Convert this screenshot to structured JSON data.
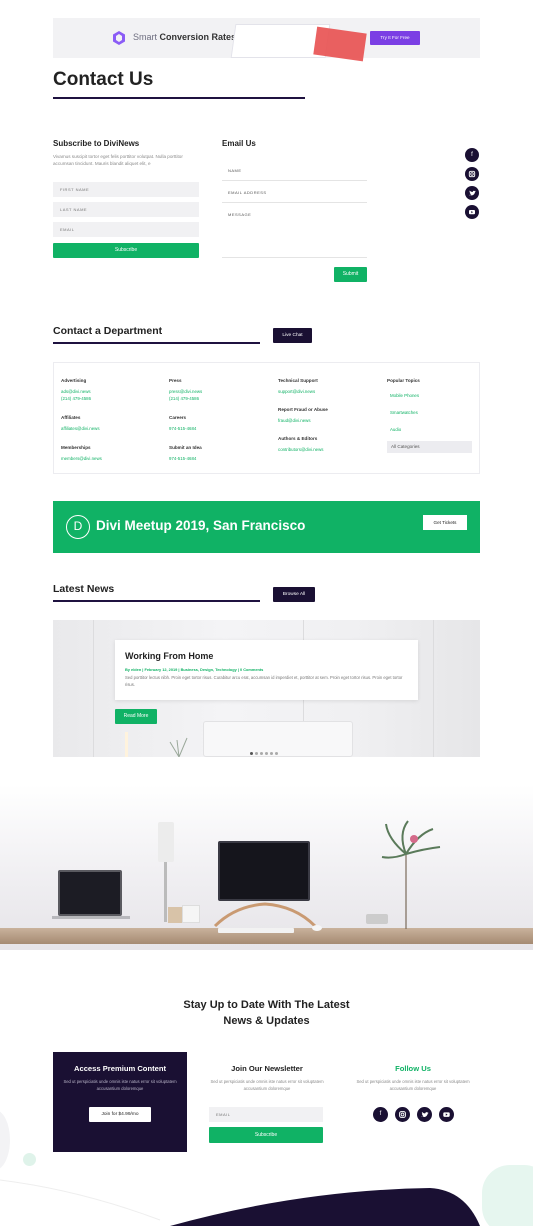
{
  "banner": {
    "brand_light": "Smart ",
    "brand_bold": "Conversion Rates",
    "button": "Try It For Free",
    "button_color": "#7b3fe4"
  },
  "page_title": "Contact Us",
  "subscribe": {
    "title": "Subscribe to DiviNews",
    "text": "Vivamus suscipit tortor eget felis porttitor volutpat. Nulla porttitor accumsan tincidunt. Mauris blandit aliquet elit, e",
    "first_name": "FIRST NAME",
    "last_name": "LAST NAME",
    "email": "EMAIL",
    "button": "Subscribe"
  },
  "email_us": {
    "title": "Email Us",
    "name": "NAME",
    "email": "EMAIL ADDRESS",
    "message": "MESSAGE",
    "button": "Submit"
  },
  "social_icons": [
    "facebook-icon",
    "instagram-icon",
    "twitter-icon",
    "youtube-icon"
  ],
  "department": {
    "title": "Contact a Department",
    "live_chat": "Live Chat",
    "col1": [
      {
        "title": "Advertising",
        "lines": [
          "ads@divi.news",
          "(214) 479-4586"
        ]
      },
      {
        "title": "Affiliates",
        "lines": [
          "affiliates@divi.news"
        ]
      },
      {
        "title": "Memberships",
        "lines": [
          "members@divi.news"
        ]
      }
    ],
    "col2": [
      {
        "title": "Press",
        "lines": [
          "press@divi.news",
          "(214) 479-4586"
        ]
      },
      {
        "title": "Careers",
        "lines": [
          "974-515-4684"
        ]
      },
      {
        "title": "Submit an Idea",
        "lines": [
          "974-515-4684"
        ]
      }
    ],
    "col3": [
      {
        "title": "Technical Support",
        "lines": [
          "support@divi.news"
        ]
      },
      {
        "title": "Report Fraud or Abuse",
        "lines": [
          "fraud@divi.news"
        ]
      },
      {
        "title": "Authors & Editors",
        "lines": [
          "contributors@divi.news"
        ]
      }
    ],
    "popular": {
      "title": "Popular Topics",
      "links": [
        "Mobile Phones",
        "Smartwatches",
        "Audio"
      ],
      "select": "All Categories"
    }
  },
  "meetup": {
    "logo_letter": "D",
    "title": "Divi Meetup 2019, San Francisco",
    "button": "Get Tickets"
  },
  "latest": {
    "title": "Latest News",
    "browse": "Browse All",
    "post_title": "Working From Home",
    "meta": "By elden | February 12, 2019 | Business, Design, Technology | 0 Comments",
    "excerpt": "Sed porttitor lectus nibh. Proin eget tortor risus. Curabitur arcu erat, accumsan id imperdiet et, porttitor at sem. Proin eget tortor risus. Proin eget tortor risus.",
    "read_more": "Read More"
  },
  "footer": {
    "title_line1": "Stay Up to Date With The Latest",
    "title_line2": "News & Updates",
    "premium_title": "Access Premium Content",
    "premium_text": "Sed ut perspiciatis unde omnis iste natus error sit voluptatem accusantium doloremque",
    "premium_button": "Join for $4.99/mo",
    "newsletter_title": "Join Our Newsletter",
    "newsletter_text": "Sed ut perspiciatis unde omnis iste natus error sit voluptatem accusantium doloremque",
    "newsletter_email": "EMAIL",
    "newsletter_button": "Subscribe",
    "follow_title": "Follow Us",
    "follow_text": "Sed ut perspiciatis unde omnis iste natus error sit voluptatem accusantium doloremque"
  },
  "colors": {
    "accent": "#10b265",
    "dark": "#1a1033"
  }
}
